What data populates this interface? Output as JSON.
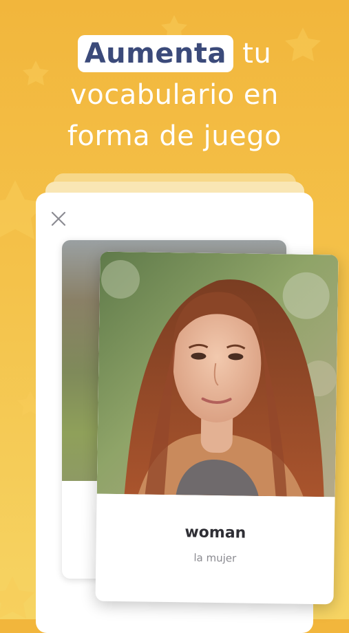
{
  "headline": {
    "highlight": "Aumenta",
    "rest_line1": " tu",
    "line2": "vocabulario en",
    "line3": "forma de juego"
  },
  "colors": {
    "background_top": "#f2b63c",
    "background_bottom": "#f6d463",
    "highlight_text": "#3b4a7a",
    "word_text": "#2f2f35",
    "translation_text": "#8a8a90"
  },
  "icons": {
    "close": "close-icon",
    "decor": "star-icon"
  },
  "flashcard": {
    "word": "woman",
    "translation": "la mujer",
    "image": "portrait of a woman with long auburn hair"
  }
}
